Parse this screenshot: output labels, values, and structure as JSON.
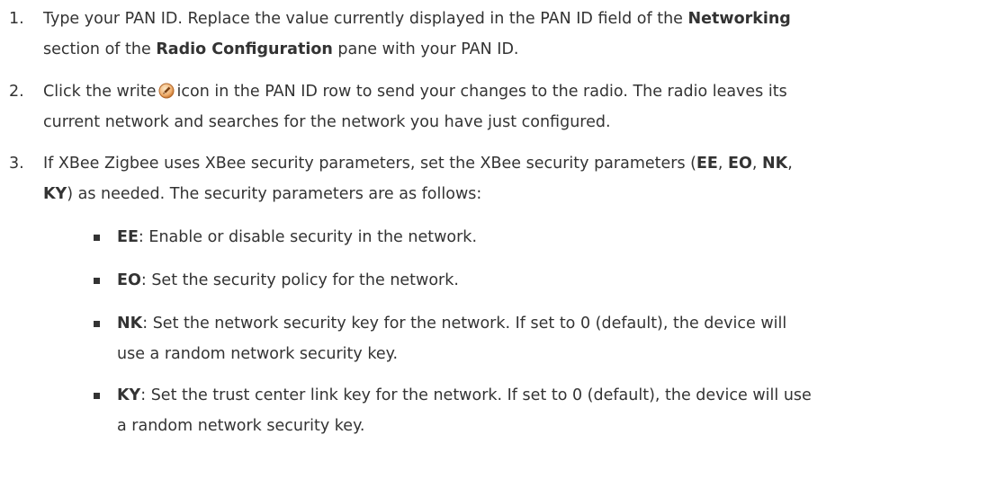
{
  "steps": [
    {
      "number": "1.",
      "lines": [
        [
          {
            "text": "Type your PAN ID. Replace the value currently displayed in the PAN ID field of the ",
            "bold": false
          },
          {
            "text": "Networking",
            "bold": true
          }
        ],
        [
          {
            "text": "section of the ",
            "bold": false
          },
          {
            "text": "Radio Configuration",
            "bold": true
          },
          {
            "text": " pane with your PAN ID.",
            "bold": false
          }
        ]
      ]
    },
    {
      "number": "2.",
      "line1_before_icon": "Click the write",
      "icon": "write-icon",
      "line1_after_icon": "icon in the PAN ID row to send your changes to the radio. The radio leaves its",
      "line2": "current network and searches for the network you have just configured."
    },
    {
      "number": "3.",
      "lines": [
        [
          {
            "text": "If XBee Zigbee uses XBee security parameters, set the XBee security parameters (",
            "bold": false
          },
          {
            "text": "EE",
            "bold": true
          },
          {
            "text": ", ",
            "bold": false
          },
          {
            "text": "EO",
            "bold": true
          },
          {
            "text": ", ",
            "bold": false
          },
          {
            "text": "NK",
            "bold": true
          },
          {
            "text": ",",
            "bold": false
          }
        ],
        [
          {
            "text": "KY",
            "bold": true
          },
          {
            "text": ") as needed. The security parameters are as follows:",
            "bold": false
          }
        ]
      ]
    }
  ],
  "security_parameters": [
    {
      "code": "EE",
      "lines": [
        "Enable or disable security in the network."
      ]
    },
    {
      "code": "EO",
      "lines": [
        "Set the security policy for the network."
      ]
    },
    {
      "code": "NK",
      "lines": [
        "Set the network security key for the network. If set to 0 (default), the device will",
        "use a random network security key."
      ]
    },
    {
      "code": "KY",
      "lines": [
        "Set the trust center link key for the network. If set to 0 (default), the device will use",
        "a random network security key."
      ]
    }
  ]
}
